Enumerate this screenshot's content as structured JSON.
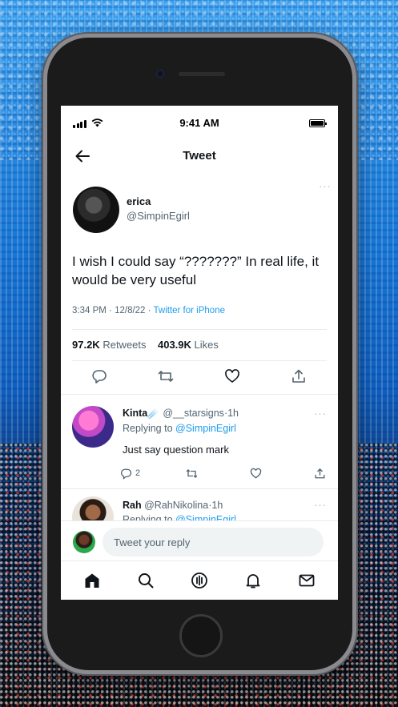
{
  "status_bar": {
    "time": "9:41 AM"
  },
  "header": {
    "title": "Tweet"
  },
  "tweet": {
    "author_name": "erica",
    "author_handle": "@SimpinEgirl",
    "text": "I wish I could say “???????” In real life, it would be very useful",
    "time": "3:34 PM",
    "date": "12/8/22",
    "separator": "·",
    "source": "Twitter for iPhone",
    "retweets_count": "97.2K",
    "retweets_label": "Retweets",
    "likes_count": "403.9K",
    "likes_label": "Likes"
  },
  "replies": [
    {
      "name": "Kinta",
      "badge": "☄️",
      "handle": "@__starsigns",
      "time_sep": "·",
      "time": "1h",
      "replying_prefix": "Replying to",
      "replying_to": "@SimpinEgirl",
      "text": "Just say question mark",
      "reply_count": "2"
    },
    {
      "name": "Rah",
      "handle": "@RahNikolina",
      "time_sep": "·",
      "time": "1h",
      "replying_prefix": "Replying to",
      "replying_to": "@SimpinEgirl"
    }
  ],
  "compose": {
    "placeholder": "Tweet your reply"
  },
  "tabs": [
    "home-icon",
    "search-icon",
    "spaces-icon",
    "notifications-icon",
    "messages-icon"
  ],
  "colors": {
    "accent": "#1d9bf0",
    "text": "#0f1419",
    "muted": "#536471"
  }
}
